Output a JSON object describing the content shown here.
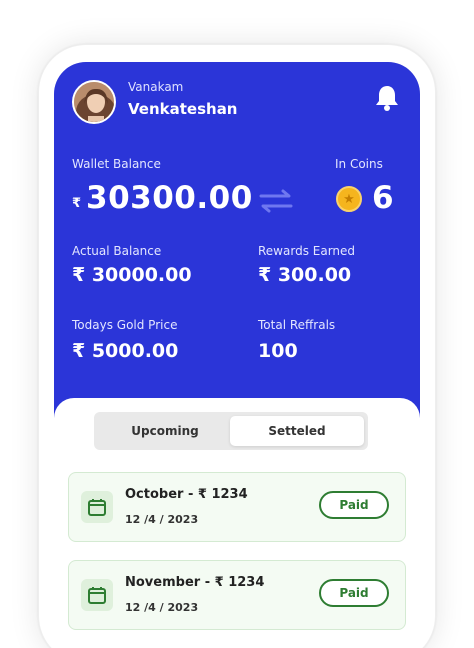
{
  "header": {
    "greeting": "Vanakam",
    "user_name": "Venkateshan"
  },
  "balances": {
    "wallet_label": "Wallet Balance",
    "wallet_currency": "₹",
    "wallet_amount": "30300.00",
    "coins_label": "In Coins",
    "coins_value": "6",
    "actual_label": "Actual Balance",
    "actual_value": "₹ 30000.00",
    "rewards_label": "Rewards Earned",
    "rewards_value": "₹ 300.00",
    "gold_label": "Todays Gold Price",
    "gold_value": "₹ 5000.00",
    "referrals_label": "Total Reffrals",
    "referrals_value": "100"
  },
  "tabs": [
    {
      "label": "Upcoming",
      "active": false
    },
    {
      "label": "Setteled",
      "active": true
    }
  ],
  "payments": [
    {
      "title": "October -  ₹ 1234",
      "date": "12 /4 / 2023",
      "status": "Paid"
    },
    {
      "title": "November -  ₹ 1234",
      "date": "12 /4 / 2023",
      "status": "Paid"
    }
  ],
  "colors": {
    "primary": "#2b35d8",
    "paid_green": "#2e7d32",
    "card_bg": "#f4fbf3",
    "coin": "#f5b51e"
  },
  "icons": [
    "bell-icon",
    "swap-arrows-icon",
    "coin-icon",
    "calendar-icon",
    "avatar"
  ]
}
